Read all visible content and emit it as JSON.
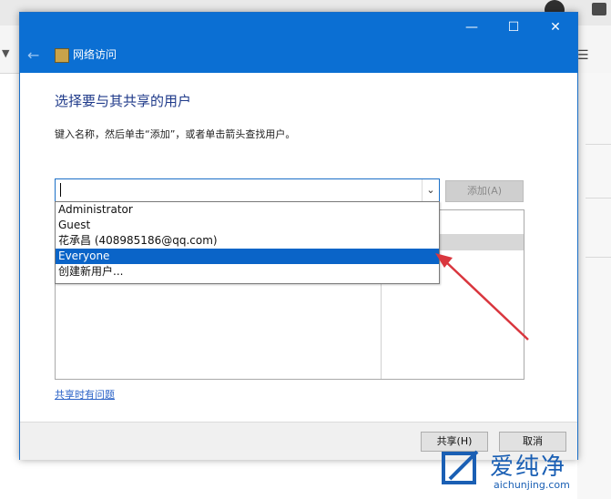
{
  "window": {
    "title": "网络访问",
    "minimize_glyph": "—",
    "maximize_glyph": "☐",
    "close_glyph": "✕"
  },
  "content": {
    "heading": "选择要与其共享的用户",
    "instruction": "键入名称，然后单击“添加”，或者单击箭头查找用户。",
    "combo_value": "",
    "add_button": "添加(A)",
    "dropdown_items": [
      "Administrator",
      "Guest",
      "花承昌 (408985186@qq.com)",
      "Everyone",
      "创建新用户..."
    ],
    "selected_item": "Everyone",
    "help_link": "共享时有问题"
  },
  "footer": {
    "share_button": "共享(H)",
    "cancel_button": "取消"
  },
  "watermark": {
    "text_cn": "爱纯净",
    "text_en": "aichunjing.com"
  },
  "colors": {
    "titlebar": "#0b6fd3",
    "selection": "#0a64c8",
    "annotation_arrow": "#d9363e",
    "watermark": "#1a5fb4"
  }
}
